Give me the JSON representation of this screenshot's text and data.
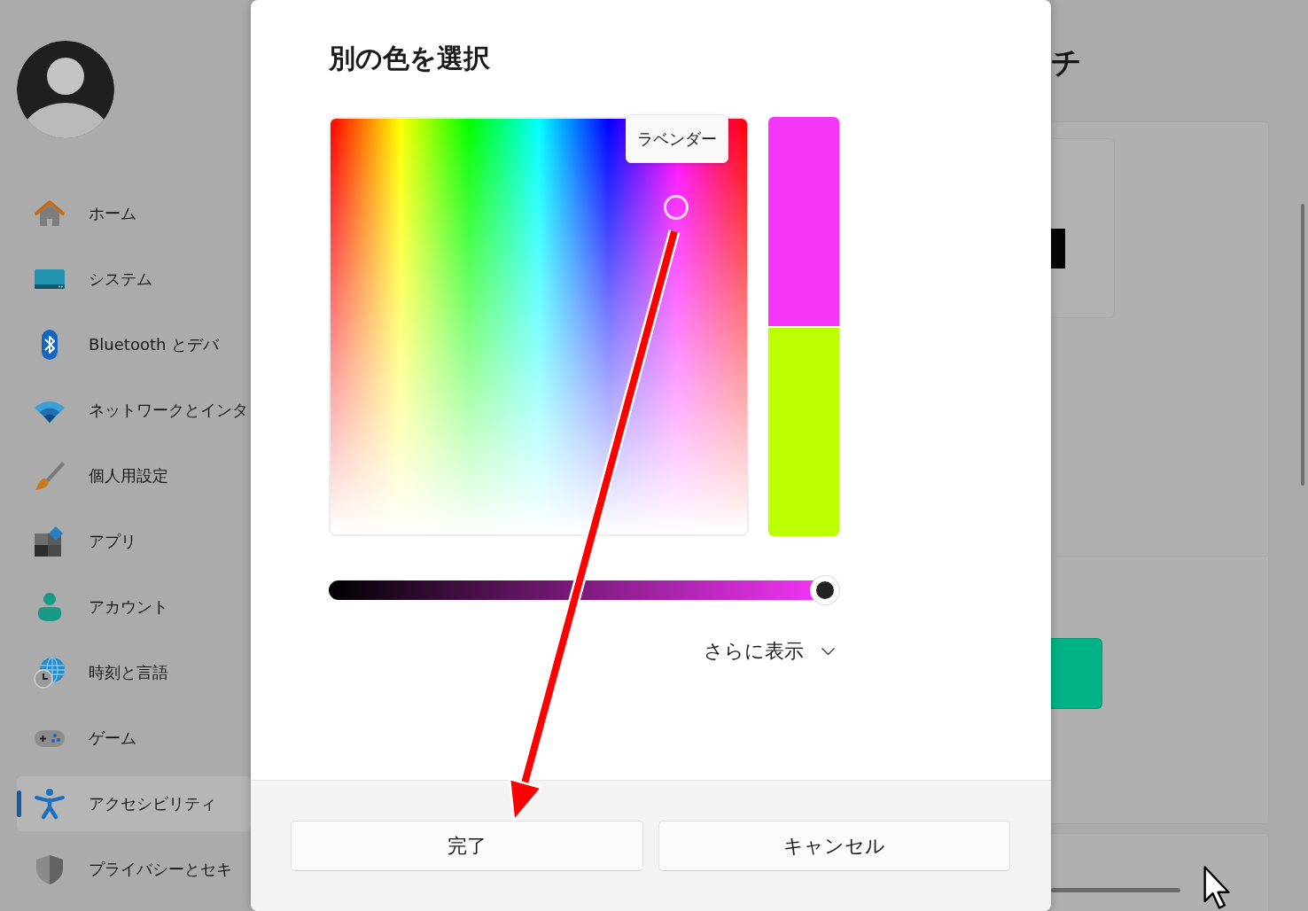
{
  "sidebar": {
    "items": [
      {
        "label": "ホーム",
        "selected": false
      },
      {
        "label": "システム",
        "selected": false
      },
      {
        "label": "Bluetooth とデバ",
        "selected": false
      },
      {
        "label": "ネットワークとインタ",
        "selected": false
      },
      {
        "label": "個人用設定",
        "selected": false
      },
      {
        "label": "アプリ",
        "selected": false
      },
      {
        "label": "アカウント",
        "selected": false
      },
      {
        "label": "時刻と言語",
        "selected": false
      },
      {
        "label": "ゲーム",
        "selected": false
      },
      {
        "label": "アクセシビリティ",
        "selected": true
      },
      {
        "label": "プライバシーとセキ",
        "selected": false
      }
    ]
  },
  "background_page": {
    "heading": "チ"
  },
  "dialog": {
    "title": "別の色を選択",
    "spectrum_tooltip": "ラベンダー",
    "preview": [
      {
        "color": "#f535f8"
      },
      {
        "color": "#bbff00"
      }
    ],
    "value_slider": {
      "level": 1
    },
    "more_toggle": {
      "label": "さらに表示",
      "expanded": false
    },
    "buttons": [
      {
        "label": "完了"
      },
      {
        "label": "キャンセル"
      }
    ]
  }
}
